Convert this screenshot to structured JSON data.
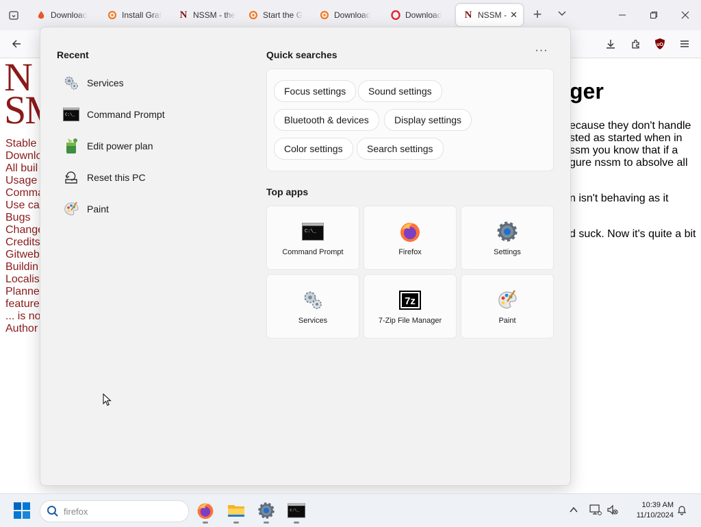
{
  "browser": {
    "tabs": [
      {
        "title": "Download",
        "icon": "flame-icon"
      },
      {
        "title": "Install Graf",
        "icon": "grafana-icon"
      },
      {
        "title": "NSSM - the",
        "icon": "nssm-n-icon"
      },
      {
        "title": "Start the G",
        "icon": "grafana-icon"
      },
      {
        "title": "Download",
        "icon": "grafana-icon"
      },
      {
        "title": "Download",
        "icon": "opera-icon"
      },
      {
        "title": "NSSM -",
        "icon": "nssm-n-icon",
        "active": true
      }
    ]
  },
  "page": {
    "logo_lines": [
      "N",
      "SM"
    ],
    "sidebar_links": [
      "Stable",
      "Downlo",
      "All buil",
      "Usage",
      "Comma",
      "Use ca",
      "Bugs",
      "Change",
      "Credits",
      "Gitweb",
      "Buildin",
      "Localis",
      "Planne",
      "feature",
      "... is no",
      "Author"
    ],
    "heading": "ger",
    "paragraphs": [
      "ecause they don't handle",
      "sted as started when in",
      "ssm you know that if a",
      "gure nssm to absolve all",
      "n isn't behaving as it",
      "d suck. Now it's quite a bit"
    ]
  },
  "start_menu": {
    "recent_title": "Recent",
    "recent": [
      {
        "label": "Services",
        "icon": "services-gears-icon"
      },
      {
        "label": "Command Prompt",
        "icon": "command-prompt-icon"
      },
      {
        "label": "Edit power plan",
        "icon": "power-plan-icon"
      },
      {
        "label": "Reset this PC",
        "icon": "reset-pc-icon"
      },
      {
        "label": "Paint",
        "icon": "paint-palette-icon"
      }
    ],
    "quick_title": "Quick searches",
    "more_label": "···",
    "quick_searches": [
      "Focus settings",
      "Sound settings",
      "Bluetooth & devices",
      "Display settings",
      "Color settings",
      "Search settings"
    ],
    "top_apps_title": "Top apps",
    "top_apps": [
      {
        "label": "Command Prompt",
        "icon": "command-prompt-icon"
      },
      {
        "label": "Firefox",
        "icon": "firefox-icon"
      },
      {
        "label": "Settings",
        "icon": "settings-gear-icon"
      },
      {
        "label": "Services",
        "icon": "services-gears-icon"
      },
      {
        "label": "7-Zip File Manager",
        "icon": "7zip-icon"
      },
      {
        "label": "Paint",
        "icon": "paint-palette-icon"
      }
    ]
  },
  "taskbar": {
    "search_value": "firefox",
    "apps": [
      "firefox-icon",
      "file-explorer-icon",
      "settings-gear-icon",
      "command-prompt-icon"
    ],
    "time": "10:39 AM",
    "date": "11/10/2024"
  },
  "colors": {
    "accent": "#0067c0",
    "link": "#8b1a1a",
    "firefox_orange": "#ff7139"
  }
}
